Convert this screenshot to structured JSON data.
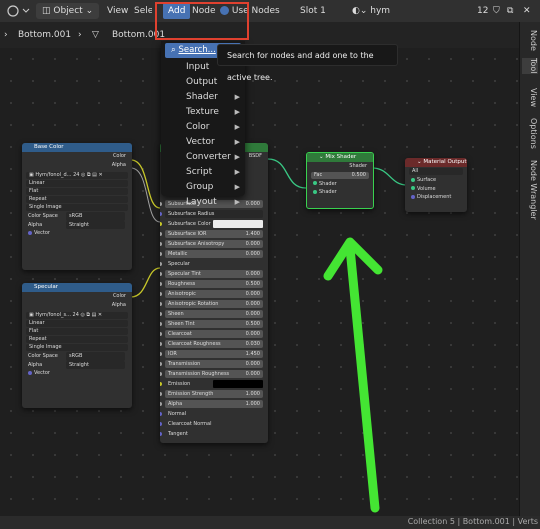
{
  "topbar": {
    "mode": "Object",
    "menus": {
      "view": "View",
      "select": "Select",
      "add": "Add",
      "node": "Node"
    },
    "use_nodes": "Use Nodes",
    "slot": "Slot 1",
    "material": "hym",
    "users": "12"
  },
  "breadcrumb": {
    "object": "Bottom.001",
    "mesh": "Bottom.001"
  },
  "add_menu": {
    "search": "Search...",
    "items": [
      "Input",
      "Output",
      "Shader",
      "Texture",
      "Color",
      "Vector",
      "Converter",
      "Script",
      "Group",
      "Layout"
    ]
  },
  "tooltip": "Search for nodes and add one to the active tree.",
  "sidebar_tabs": [
    "Node",
    "Tool",
    "View",
    "Options",
    "Node Wrangler"
  ],
  "status": "Collection 5 | Bottom.001 | Verts",
  "nodes": {
    "base_color": {
      "title": "Base Color",
      "out_color": "Color",
      "out_alpha": "Alpha",
      "image": "Hym/fonol_d...",
      "users": "24",
      "interp": "Linear",
      "proj": "Flat",
      "ext": "Repeat",
      "source": "Single Image",
      "cs_label": "Color Space",
      "cs_value": "sRGB",
      "alpha_label": "Alpha",
      "alpha_value": "Straight",
      "vector": "Vector"
    },
    "specular": {
      "title": "Specular",
      "out_color": "Color",
      "out_alpha": "Alpha",
      "image": "Hym/fonol_s...",
      "users": "24",
      "interp": "Linear",
      "proj": "Flat",
      "ext": "Repeat",
      "source": "Single Image",
      "cs_label": "Color Space",
      "cs_value": "sRGB",
      "alpha_label": "Alpha",
      "alpha_value": "Straight",
      "vector": "Vector"
    },
    "bsdf": {
      "out": "BSDF",
      "rows": [
        {
          "label": "Subsurface",
          "value": "0.000",
          "kind": "field"
        },
        {
          "label": "Subsurface Radius",
          "value": "",
          "kind": "dd"
        },
        {
          "label": "Subsurface Color",
          "value": "",
          "kind": "white"
        },
        {
          "label": "Subsurface IOR",
          "value": "1.400",
          "kind": "field"
        },
        {
          "label": "Subsurface Anisotropy",
          "value": "0.000",
          "kind": "field"
        },
        {
          "label": "Metallic",
          "value": "0.000",
          "kind": "field"
        },
        {
          "label": "Specular",
          "value": "",
          "kind": "plain"
        },
        {
          "label": "Specular Tint",
          "value": "0.000",
          "kind": "field"
        },
        {
          "label": "Roughness",
          "value": "0.500",
          "kind": "field"
        },
        {
          "label": "Anisotropic",
          "value": "0.000",
          "kind": "field"
        },
        {
          "label": "Anisotropic Rotation",
          "value": "0.000",
          "kind": "field"
        },
        {
          "label": "Sheen",
          "value": "0.000",
          "kind": "field"
        },
        {
          "label": "Sheen Tint",
          "value": "0.500",
          "kind": "field"
        },
        {
          "label": "Clearcoat",
          "value": "0.000",
          "kind": "field"
        },
        {
          "label": "Clearcoat Roughness",
          "value": "0.030",
          "kind": "field"
        },
        {
          "label": "IOR",
          "value": "1.450",
          "kind": "field"
        },
        {
          "label": "Transmission",
          "value": "0.000",
          "kind": "field"
        },
        {
          "label": "Transmission Roughness",
          "value": "0.000",
          "kind": "field"
        },
        {
          "label": "Emission",
          "value": "",
          "kind": "black"
        },
        {
          "label": "Emission Strength",
          "value": "1.000",
          "kind": "field"
        },
        {
          "label": "Alpha",
          "value": "1.000",
          "kind": "field"
        },
        {
          "label": "Normal",
          "value": "",
          "kind": "plain"
        },
        {
          "label": "Clearcoat Normal",
          "value": "",
          "kind": "plain"
        },
        {
          "label": "Tangent",
          "value": "",
          "kind": "plain"
        }
      ]
    },
    "mix": {
      "title": "Mix Shader",
      "out": "Shader",
      "fac_label": "Fac",
      "fac_value": "0.500",
      "in1": "Shader",
      "in2": "Shader"
    },
    "output": {
      "title": "Material Output",
      "target": "All",
      "surface": "Surface",
      "volume": "Volume",
      "displacement": "Displacement"
    }
  },
  "colors": {
    "accent": "#4772b3",
    "highlight_box": "#e0412f",
    "arrow": "#44e533",
    "node_texture": "#2f5c8a",
    "node_shader": "#2f7a3a",
    "node_output": "#6b2a2a"
  }
}
